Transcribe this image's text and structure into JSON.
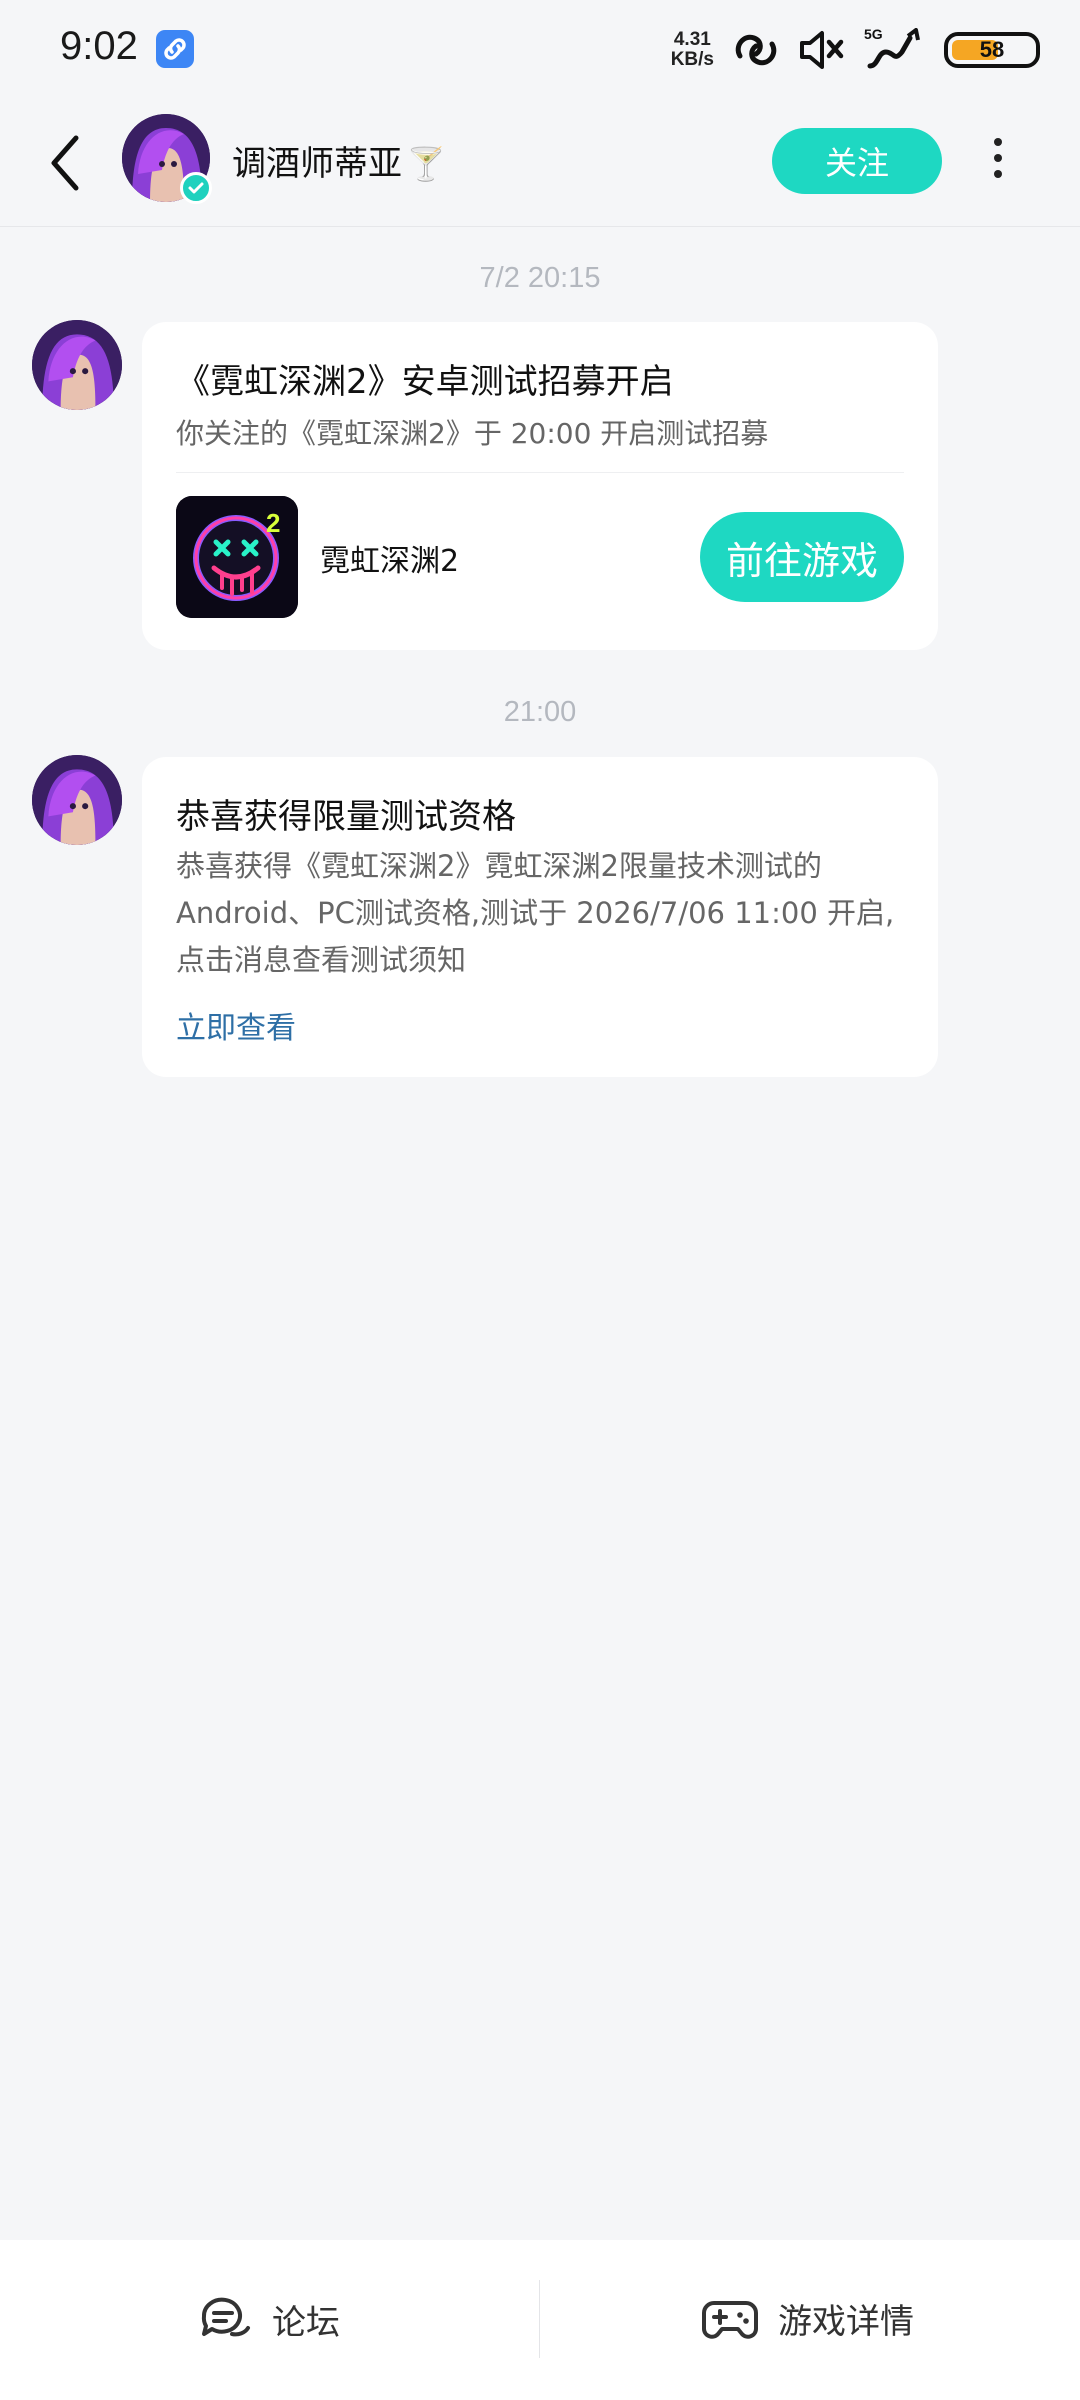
{
  "status_bar": {
    "time": "9:02",
    "network_speed_value": "4.31",
    "network_speed_unit": "KB/s",
    "signal_label": "5G",
    "battery": "58",
    "battery_level_percent": 58
  },
  "header": {
    "title": "调酒师蒂亚",
    "title_emoji": "🍸",
    "follow_label": "关注"
  },
  "messages": [
    {
      "timestamp": "7/2  20:15",
      "title": "《霓虹深渊2》安卓测试招募开启",
      "subtitle": "你关注的《霓虹深渊2》于 20:00 开启测试招募",
      "game_name": "霓虹深渊2",
      "action_label": "前往游戏"
    },
    {
      "timestamp": "21:00",
      "title": "恭喜获得限量测试资格",
      "body_lines": [
        "恭喜获得《霓虹深渊2》霓虹深渊2限量技术测试的",
        "Android、PC测试资格,测试于 2026/7/06 11:00 开启,",
        "点击消息查看测试须知"
      ],
      "link_label": "立即查看"
    }
  ],
  "bottom_bar": {
    "forum_label": "论坛",
    "game_details_label": "游戏详情"
  },
  "colors": {
    "accent": "#1ed8c2",
    "link": "#2e6fa6",
    "background": "#f5f6f8"
  }
}
